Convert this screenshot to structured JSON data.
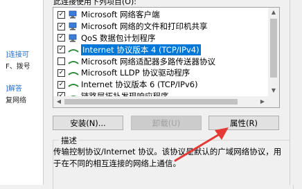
{
  "background_window": {
    "link1": "]连接可",
    "text1": "F、拨号",
    "link2": "]解答",
    "text2": "复网络"
  },
  "dialog": {
    "list_caption": "此连接使用下列项目(O):",
    "items": [
      {
        "label": "Microsoft 网络客户端",
        "checked": true,
        "icon": "network-client-icon"
      },
      {
        "label": "Microsoft 网络的文件和打印机共享",
        "checked": true,
        "icon": "file-printer-sharing-icon"
      },
      {
        "label": "QoS 数据包计划程序",
        "checked": true,
        "icon": "qos-icon"
      },
      {
        "label": "Internet 协议版本 4 (TCP/IPv4)",
        "checked": true,
        "icon": "protocol-icon",
        "selected": true
      },
      {
        "label": "Microsoft 网络适配器多路传送器协议",
        "checked": false,
        "icon": "protocol-icon"
      },
      {
        "label": "Microsoft LLDP 协议驱动程序",
        "checked": true,
        "icon": "protocol-icon"
      },
      {
        "label": "Internet 协议版本 6 (TCP/IPv6)",
        "checked": true,
        "icon": "protocol-icon"
      },
      {
        "label": "链路层拓扑发现响应程序",
        "checked": true,
        "icon": "protocol-icon"
      }
    ],
    "buttons": {
      "install": "安装(N)...",
      "uninstall": "卸载(U)",
      "properties": "属性(R)"
    },
    "description": {
      "title": "描述",
      "text_line1": "传输控制协议/Internet 协议。该协议是默认的广域网络协议，用",
      "text_line2": "于在不同的相互连接的网络上通信。"
    },
    "colors": {
      "selection": "#0078d7",
      "annotation_arrow": "#e53935"
    }
  }
}
